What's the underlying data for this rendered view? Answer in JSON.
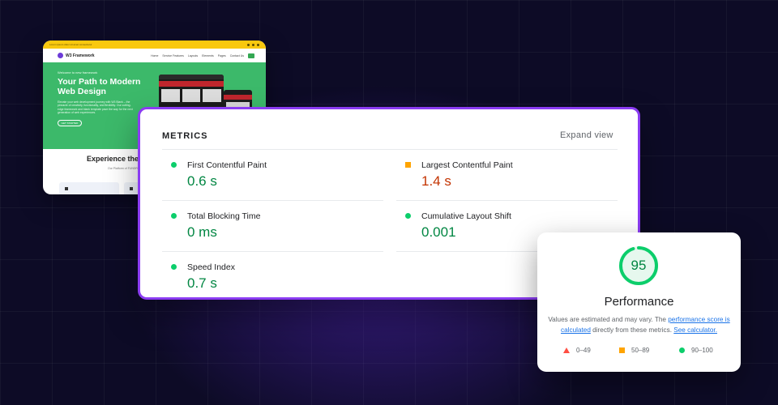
{
  "website": {
    "topbar_text": "Lorem ipsum dolor sit amet consectetur",
    "logo_name": "W3 Framework",
    "menu": [
      "Home",
      "Service Features",
      "Layouts",
      "Elements",
      "Pages",
      "Contact Us"
    ],
    "hero_tag": "Welcome to new framework",
    "hero_title": "Your Path to Modern Web Design",
    "hero_text": "Elevate your web development journey with W3 Blank – the pinnacle of creativity, functionality, and flexibility. Our cutting-edge framework and blank template pave the way for the next generation of web experiences.",
    "hero_button": "GET STARTED",
    "section_title": "Experience the F",
    "section_sub": "Our Platform of FUNDRISING · Need to create eve"
  },
  "metrics": {
    "title": "METRICS",
    "expand_label": "Expand view",
    "items": [
      {
        "label": "First Contentful Paint",
        "value": "0.6 s",
        "status": "pass"
      },
      {
        "label": "Largest Contentful Paint",
        "value": "1.4 s",
        "status": "average"
      },
      {
        "label": "Total Blocking Time",
        "value": "0 ms",
        "status": "pass"
      },
      {
        "label": "Cumulative Layout Shift",
        "value": "0.001",
        "status": "pass"
      },
      {
        "label": "Speed Index",
        "value": "0.7 s",
        "status": "pass"
      }
    ]
  },
  "performance": {
    "score": "95",
    "score_fraction": 0.95,
    "title": "Performance",
    "note_prefix": "Values are estimated and may vary. The ",
    "note_link1": "performance score is calculated",
    "note_middle": " directly from these metrics. ",
    "note_link2": "See calculator.",
    "legend": {
      "fail": "0–49",
      "average": "50–89",
      "pass": "90–100"
    }
  },
  "colors": {
    "accent_border": "#8b3cf2",
    "pass": "#0cce6b",
    "pass_text": "#018642",
    "average": "#ffa400",
    "average_text": "#c33300",
    "fail": "#ff4e42",
    "link": "#1a73e8"
  }
}
